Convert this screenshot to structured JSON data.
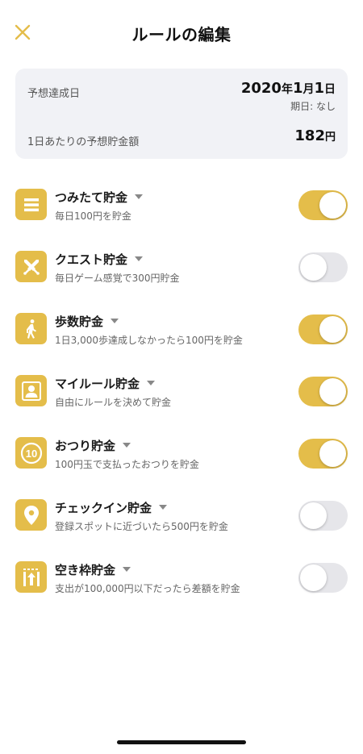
{
  "header": {
    "title": "ルールの編集",
    "close_icon": "close-icon"
  },
  "summary": {
    "target_date_label": "予想達成日",
    "target_date": {
      "year": "2020",
      "year_unit": "年",
      "month": "1",
      "month_unit": "月",
      "day": "1",
      "day_unit": "日"
    },
    "due_text": "期日: なし",
    "daily_label": "1日あたりの予想貯金額",
    "daily_amount": "182",
    "daily_unit": "円"
  },
  "rules": [
    {
      "name": "つみたて貯金",
      "desc": "毎日100円を貯金",
      "icon": "list-icon",
      "enabled": true
    },
    {
      "name": "クエスト貯金",
      "desc": "毎日ゲーム感覚で300円貯金",
      "icon": "crossed-swords-icon",
      "enabled": false
    },
    {
      "name": "歩数貯金",
      "desc": "1日3,000歩達成しなかったら100円を貯金",
      "icon": "walking-person-icon",
      "enabled": true
    },
    {
      "name": "マイルール貯金",
      "desc": "自由にルールを決めて貯金",
      "icon": "person-icon",
      "enabled": true
    },
    {
      "name": "おつり貯金",
      "desc": "100円玉で支払ったおつりを貯金",
      "icon": "coin-10-icon",
      "enabled": true
    },
    {
      "name": "チェックイン貯金",
      "desc": "登録スポットに近づいたら500円を貯金",
      "icon": "map-pin-icon",
      "enabled": false
    },
    {
      "name": "空き枠貯金",
      "desc": "支出が100,000円以下だったら差額を貯金",
      "icon": "limit-up-icon",
      "enabled": false
    }
  ],
  "colors": {
    "accent": "#e4bd4a",
    "toggle_off": "#e6e6ea",
    "summary_bg": "#f1f2f6"
  }
}
